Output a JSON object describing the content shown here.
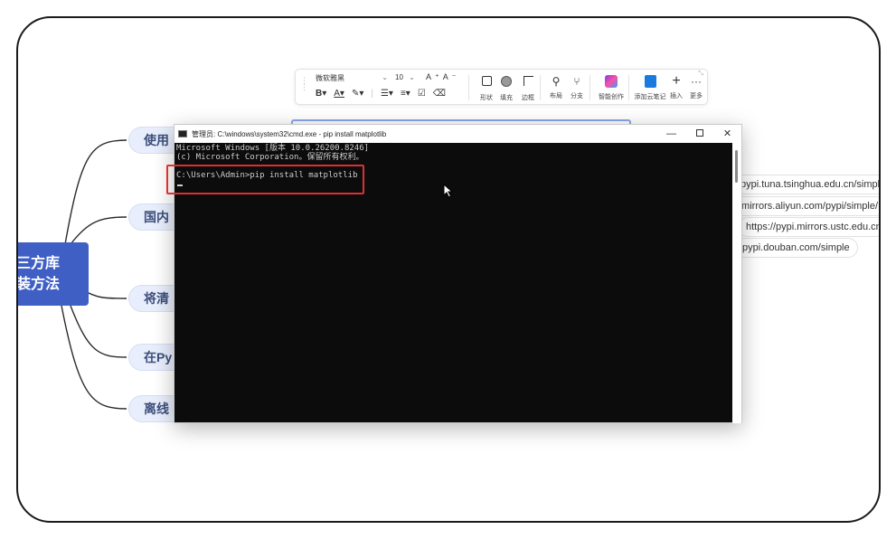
{
  "mindmap": {
    "root_lines": [
      "三方库",
      "装方法"
    ],
    "branches": [
      "使用",
      "国内",
      "将清",
      "在Py",
      "离线"
    ],
    "mirrors": [
      "pypi.tuna.tsinghua.edu.cn/simple",
      "/mirrors.aliyun.com/pypi/simple/",
      "https://pypi.mirrors.ustc.edu.cn/",
      "pypi.douban.com/simple"
    ],
    "colors": {
      "root": "#3f5fc5",
      "branch_bg": "#e8eefb",
      "branch_text": "#3d4f7c"
    }
  },
  "toolbar": {
    "font_name": "微软雅黑",
    "font_size": "10",
    "buttons": [
      {
        "label": "形状",
        "icon": "shape-square-icon"
      },
      {
        "label": "填充",
        "icon": "fill-circle-icon"
      },
      {
        "label": "边框",
        "icon": "border-icon"
      },
      {
        "label": "布局",
        "icon": "layout-icon"
      },
      {
        "label": "分支",
        "icon": "branch-icon"
      },
      {
        "label": "智能创作",
        "icon": "ai-create-icon"
      },
      {
        "label": "添加云笔记",
        "icon": "cloud-note-icon"
      },
      {
        "label": "插入",
        "icon": "plus-icon"
      },
      {
        "label": "更多",
        "icon": "more-icon"
      }
    ]
  },
  "terminal": {
    "title": "管理员: C:\\windows\\system32\\cmd.exe - pip  install matplotlib",
    "lines": [
      "Microsoft Windows [版本 10.0.26200.8246]",
      "(c) Microsoft Corporation。保留所有权利。"
    ],
    "command": "C:\\Users\\Admin>pip install matplotlib",
    "highlight_color": "#e02f2f"
  }
}
